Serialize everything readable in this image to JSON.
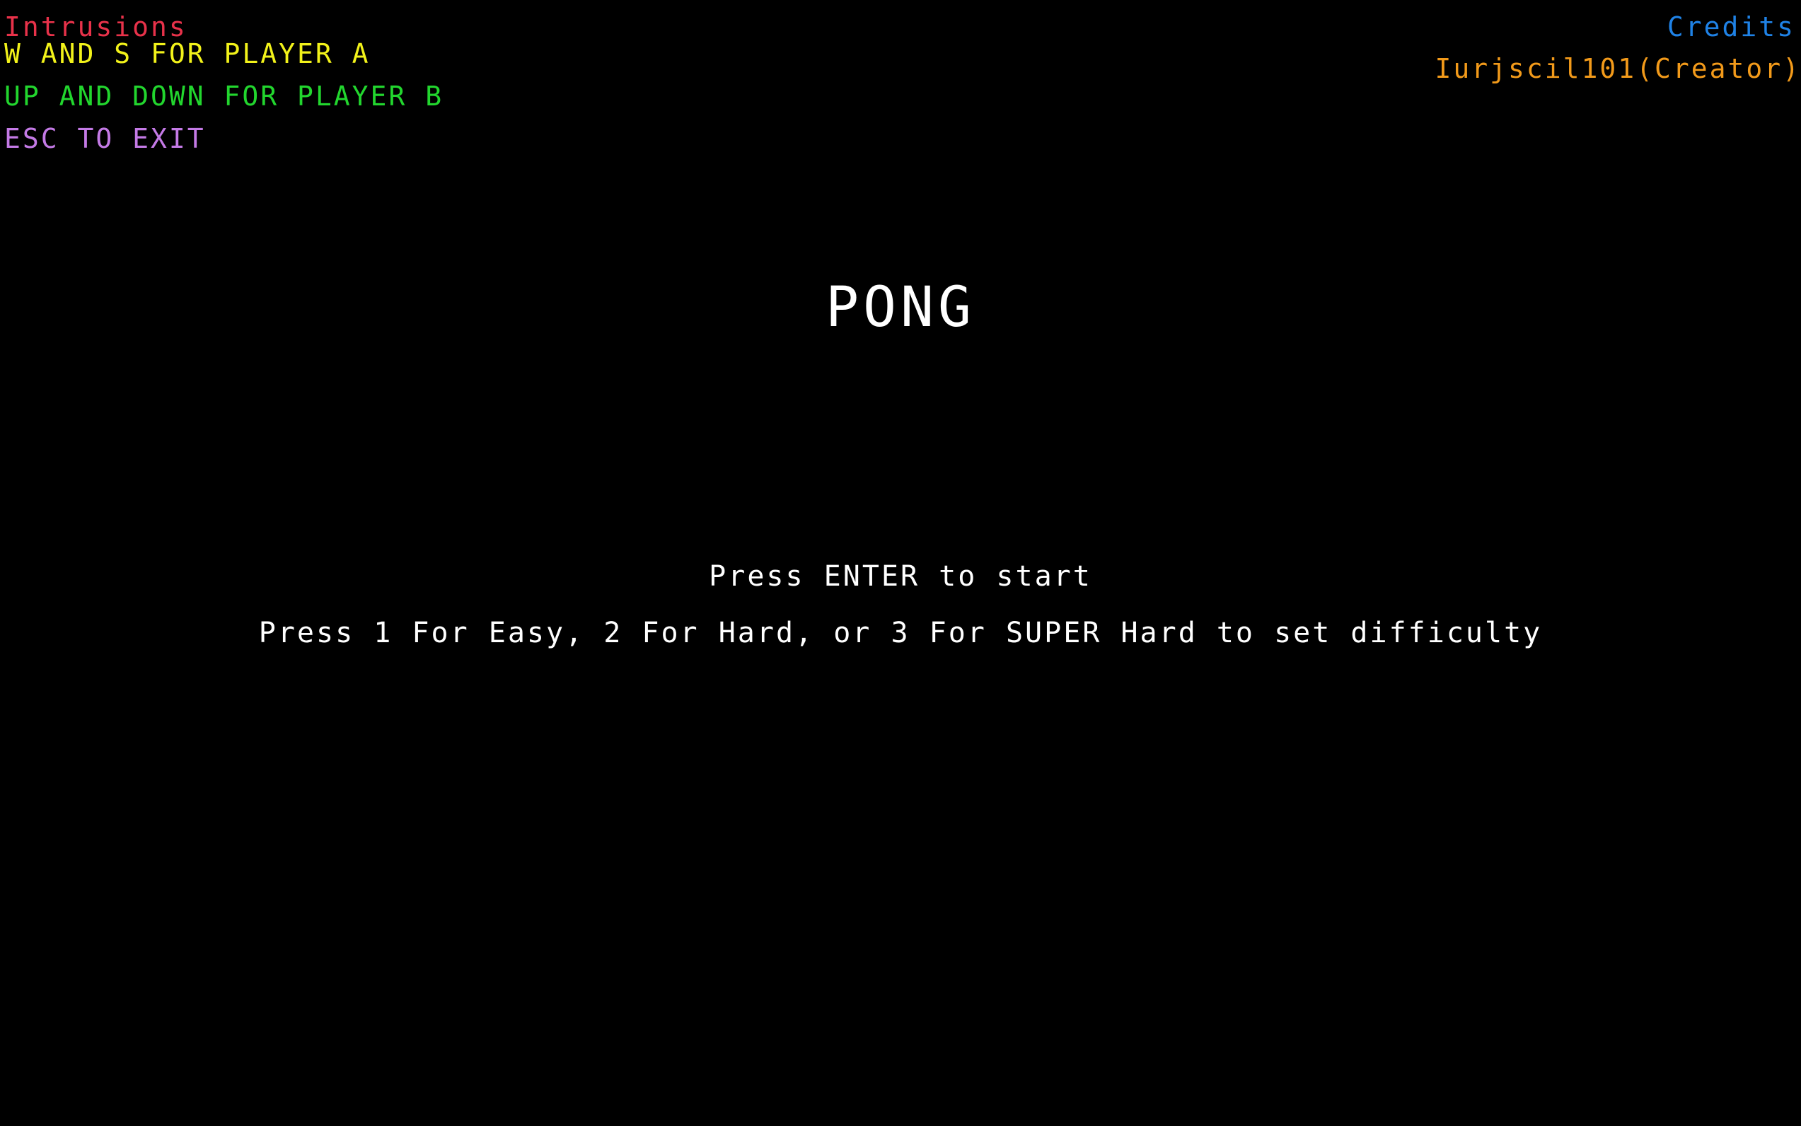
{
  "instructions": {
    "title": "Intrusions",
    "lines": [
      "W AND S FOR PLAYER A",
      "UP AND DOWN FOR PLAYER B",
      "ESC TO EXIT"
    ]
  },
  "credits": {
    "title": "Credits",
    "creator": "Iurjscil101(Creator)"
  },
  "game": {
    "title": "PONG",
    "start_prompt": "Press ENTER to start",
    "difficulty_prompt": "Press 1 For Easy, 2 For Hard, or 3 For SUPER Hard to set difficulty"
  },
  "colors": {
    "background": "#000000",
    "instructions_title": "#e8324a",
    "player_a": "#f2f21a",
    "player_b": "#22d62e",
    "exit": "#c47ae6",
    "credits_title": "#1f82e6",
    "creator": "#f29a1a",
    "main_text": "#ffffff"
  }
}
